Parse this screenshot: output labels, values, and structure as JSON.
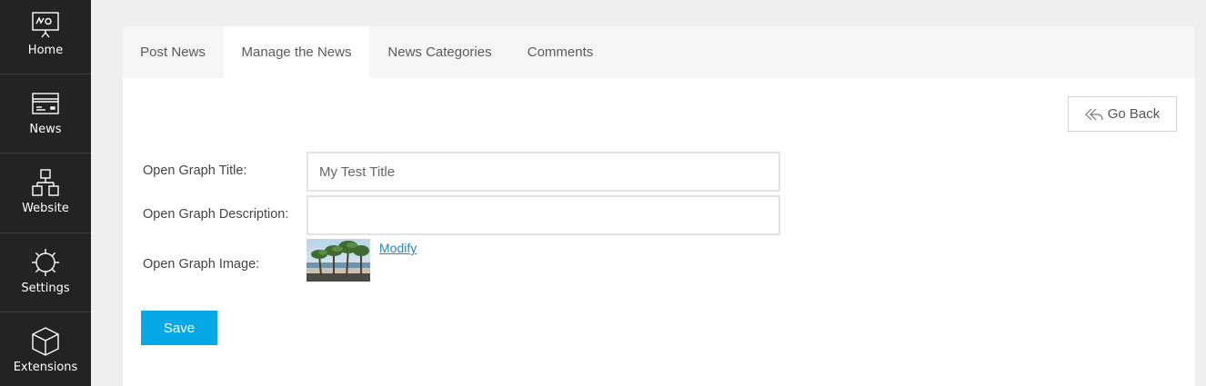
{
  "sidebar": {
    "items": [
      {
        "label": "Home",
        "icon": "presentation-board-icon"
      },
      {
        "label": "News",
        "icon": "news-card-icon"
      },
      {
        "label": "Website",
        "icon": "sitemap-icon"
      },
      {
        "label": "Settings",
        "icon": "gear-icon"
      },
      {
        "label": "Extensions",
        "icon": "cube-icon"
      }
    ]
  },
  "tabs": [
    {
      "label": "Post News",
      "active": false
    },
    {
      "label": "Manage the News",
      "active": true
    },
    {
      "label": "News Categories",
      "active": false
    },
    {
      "label": "Comments",
      "active": false
    }
  ],
  "toolbar": {
    "go_back_label": "Go Back",
    "go_back_icon": "reply-arrow-icon"
  },
  "form": {
    "og_title_label": "Open Graph Title:",
    "og_title_value": "My Test Title",
    "og_description_label": "Open Graph Description:",
    "og_description_value": "",
    "og_image_label": "Open Graph Image:",
    "modify_label": "Modify",
    "save_label": "Save"
  },
  "colors": {
    "sidebar_bg": "#232323",
    "accent": "#06a8e6",
    "link": "#1e88c9",
    "page_bg": "#efefef"
  }
}
